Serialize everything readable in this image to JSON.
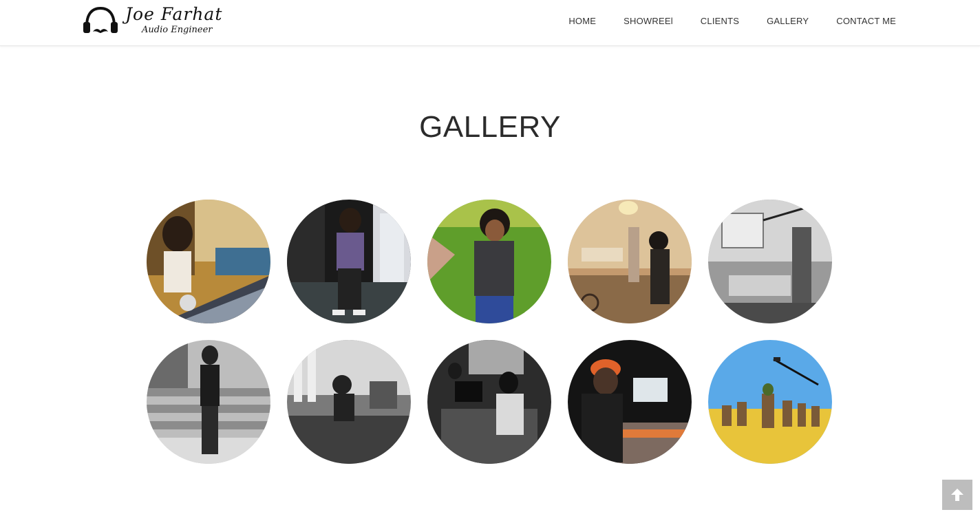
{
  "brand": {
    "name": "Joe Farhat",
    "tagline": "Audio Engineer",
    "icon": "headphones-mustache-icon"
  },
  "nav": {
    "items": [
      {
        "label": "HOME"
      },
      {
        "label": "SHOWREEl"
      },
      {
        "label": "CLIENTS"
      },
      {
        "label": "GALLERY"
      },
      {
        "label": "CONTACT ME"
      }
    ]
  },
  "gallery": {
    "title": "GALLERY",
    "photos": [
      {
        "scene": "studio-mixing-console"
      },
      {
        "scene": "store-portrait"
      },
      {
        "scene": "outdoor-lawn-portrait"
      },
      {
        "scene": "indoor-room-set"
      },
      {
        "scene": "office-boom-mic-bw"
      },
      {
        "scene": "steps-field-recorder-bw"
      },
      {
        "scene": "interior-set-bw"
      },
      {
        "scene": "mixing-desk-bw"
      },
      {
        "scene": "studio-console-orange-cap"
      },
      {
        "scene": "desert-riders-boom"
      }
    ]
  },
  "back_to_top": {
    "icon": "arrow-up-icon"
  },
  "colors": {
    "text": "#333333",
    "header_border": "#e6e6e6",
    "back_to_top_bg": "#bdbdbd"
  }
}
